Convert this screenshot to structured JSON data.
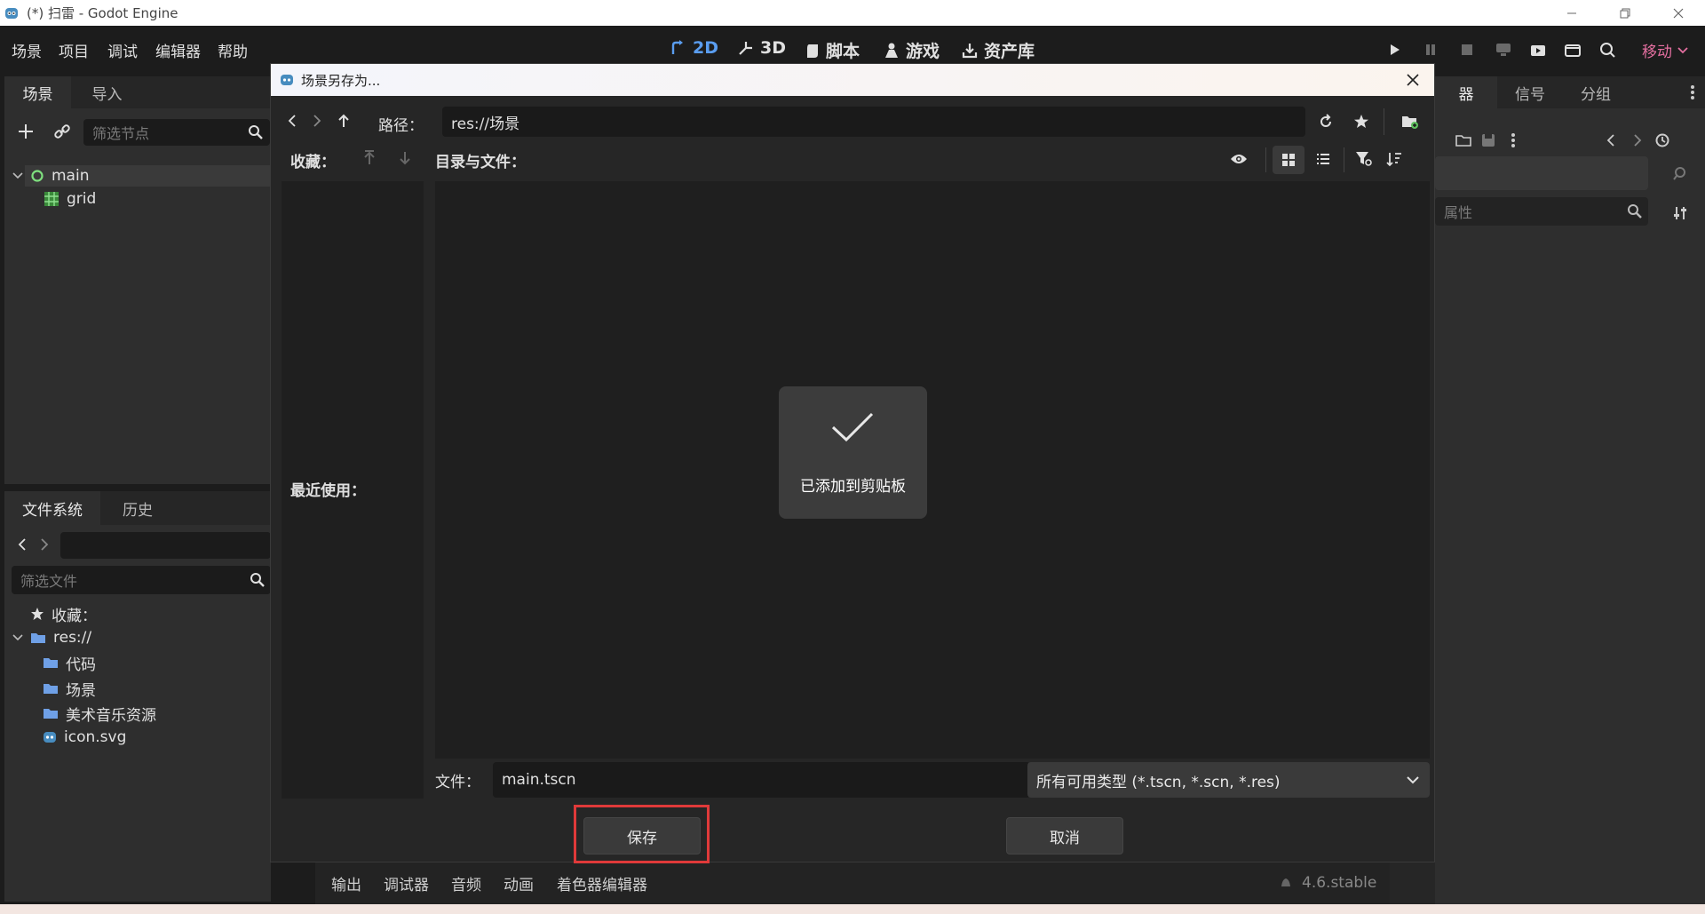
{
  "window": {
    "title": "(*) 扫雷 - Godot Engine",
    "controls": [
      "minimize",
      "restore",
      "close"
    ]
  },
  "menubar": {
    "menus": [
      "场景",
      "项目",
      "调试",
      "编辑器",
      "帮助"
    ],
    "modes": [
      {
        "label": "2D",
        "icon": "2d-icon",
        "active": true
      },
      {
        "label": "3D",
        "icon": "3d-icon",
        "active": false
      },
      {
        "label": "脚本",
        "icon": "script-icon",
        "active": false
      },
      {
        "label": "游戏",
        "icon": "game-icon",
        "active": false
      },
      {
        "label": "资产库",
        "icon": "assetlib-icon",
        "active": false
      }
    ],
    "renderer": "移动"
  },
  "scene_dock": {
    "tabs": [
      "场景",
      "导入"
    ],
    "filter_placeholder": "筛选节点",
    "nodes": [
      {
        "name": "main",
        "icon": "node-icon"
      },
      {
        "name": "grid",
        "icon": "gridmap-icon"
      }
    ]
  },
  "filesystem_dock": {
    "tabs": [
      "文件系统",
      "历史"
    ],
    "filter_placeholder": "筛选文件",
    "items": [
      {
        "label": "收藏：",
        "icon": "star-icon"
      },
      {
        "label": "res://",
        "icon": "folder-icon"
      },
      {
        "label": "代码",
        "icon": "folder-icon"
      },
      {
        "label": "场景",
        "icon": "folder-icon"
      },
      {
        "label": "美术音乐资源",
        "icon": "folder-icon"
      },
      {
        "label": "icon.svg",
        "icon": "godot-icon"
      }
    ]
  },
  "inspector_dock": {
    "tabs": [
      "器",
      "信号",
      "分组"
    ],
    "filter_placeholder": "属性"
  },
  "dialog": {
    "title": "场景另存为...",
    "path_label": "路径：",
    "path_value": "res://场景",
    "favorites_label": "收藏：",
    "recent_label": "最近使用：",
    "dirs_label": "目录与文件：",
    "file_label": "文件：",
    "file_value": "main.tscn",
    "filter_value": "所有可用类型 (*.tscn, *.scn, *.res)",
    "save_button": "保存",
    "cancel_button": "取消",
    "toast": "已添加到剪贴板"
  },
  "bottom_panel": {
    "tabs": [
      "输出",
      "调试器",
      "音频",
      "动画",
      "着色器编辑器"
    ],
    "version": "4.6.stable"
  },
  "colors": {
    "accent": "#5a9df0",
    "renderer": "#e46fa0",
    "highlight": "#e03a3a"
  }
}
